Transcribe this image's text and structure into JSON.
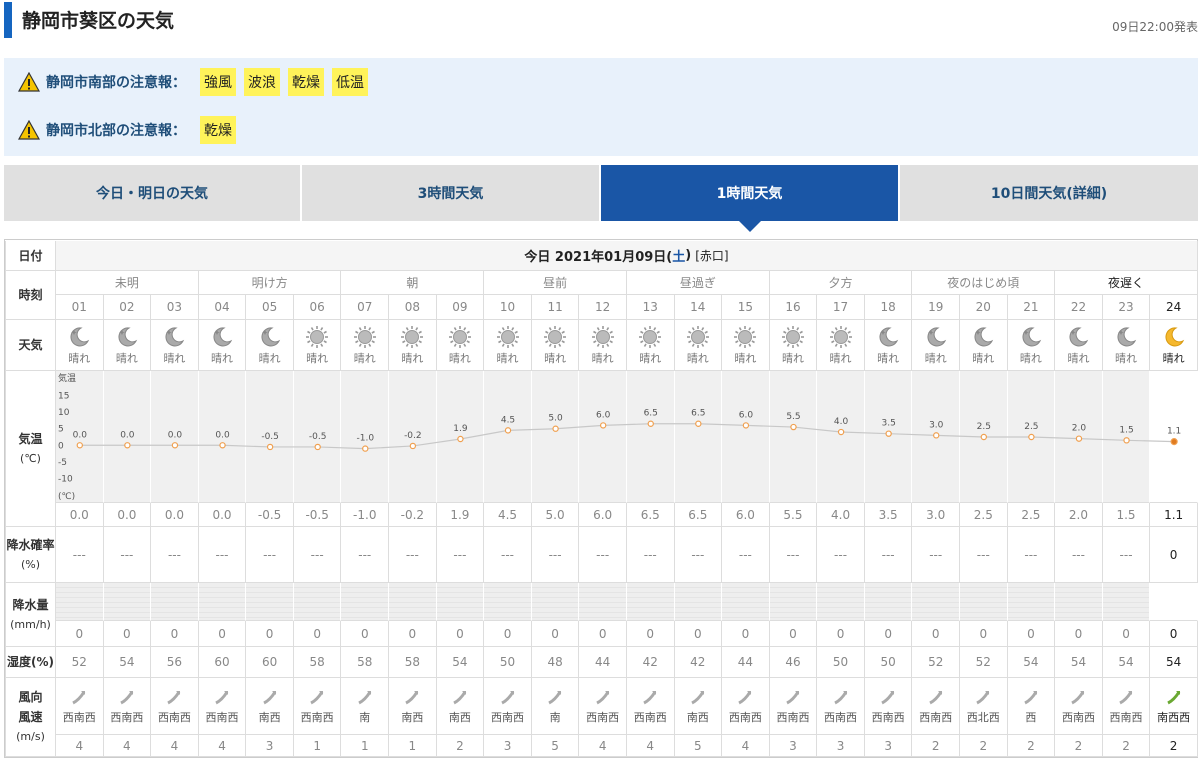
{
  "page": {
    "title": "静岡市葵区の天気",
    "published": "09日22:00発表"
  },
  "warnings": [
    {
      "label": "静岡市南部の注意報：",
      "items": [
        "強風",
        "波浪",
        "乾燥",
        "低温"
      ]
    },
    {
      "label": "静岡市北部の注意報：",
      "items": [
        "乾燥"
      ]
    }
  ],
  "tabs": [
    "今日・明日の天気",
    "3時間天気",
    "1時間天気",
    "10日間天気(詳細)"
  ],
  "active_tab": 2,
  "table": {
    "labels": {
      "date": "日付",
      "time": "時刻",
      "weather": "天気",
      "temp": "気温",
      "temp_unit": "(℃)",
      "precip_prob": "降水確率",
      "precip_prob_unit": "(%)",
      "precip": "降水量",
      "precip_unit": "(mm/h)",
      "humidity": "湿度(%)",
      "wind1": "風向",
      "wind2": "風速",
      "wind_unit": "(m/s)"
    },
    "date_prefix": "今日 2021年01月09日(",
    "day": "土",
    "date_suffix": ")",
    "location": "[赤口]",
    "periods": [
      "未明",
      "明け方",
      "朝",
      "昼前",
      "昼過ぎ",
      "夕方",
      "夜のはじめ頃",
      "夜遅く"
    ],
    "hours": [
      "01",
      "02",
      "03",
      "04",
      "05",
      "06",
      "07",
      "08",
      "09",
      "10",
      "11",
      "12",
      "13",
      "14",
      "15",
      "16",
      "17",
      "18",
      "19",
      "20",
      "21",
      "22",
      "23",
      "24"
    ],
    "weather": [
      "晴れ",
      "晴れ",
      "晴れ",
      "晴れ",
      "晴れ",
      "晴れ",
      "晴れ",
      "晴れ",
      "晴れ",
      "晴れ",
      "晴れ",
      "晴れ",
      "晴れ",
      "晴れ",
      "晴れ",
      "晴れ",
      "晴れ",
      "晴れ",
      "晴れ",
      "晴れ",
      "晴れ",
      "晴れ",
      "晴れ",
      "晴れ"
    ],
    "weather_icons": [
      "moon-icon",
      "moon-icon",
      "moon-icon",
      "moon-icon",
      "moon-icon",
      "sun-icon",
      "sun-icon",
      "sun-icon",
      "sun-icon",
      "sun-icon",
      "sun-icon",
      "sun-icon",
      "sun-icon",
      "sun-icon",
      "sun-icon",
      "sun-icon",
      "sun-icon",
      "moon-icon",
      "moon-icon",
      "moon-icon",
      "moon-icon",
      "moon-icon",
      "moon-icon",
      "moon-icon"
    ],
    "temps": [
      "0.0",
      "0.0",
      "0.0",
      "0.0",
      "-0.5",
      "-0.5",
      "-1.0",
      "-0.2",
      "1.9",
      "4.5",
      "5.0",
      "6.0",
      "6.5",
      "6.5",
      "6.0",
      "5.5",
      "4.0",
      "3.5",
      "3.0",
      "2.5",
      "2.5",
      "2.0",
      "1.5",
      "1.1"
    ],
    "precip_prob": [
      "---",
      "---",
      "---",
      "---",
      "---",
      "---",
      "---",
      "---",
      "---",
      "---",
      "---",
      "---",
      "---",
      "---",
      "---",
      "---",
      "---",
      "---",
      "---",
      "---",
      "---",
      "---",
      "---",
      "0"
    ],
    "precip": [
      "0",
      "0",
      "0",
      "0",
      "0",
      "0",
      "0",
      "0",
      "0",
      "0",
      "0",
      "0",
      "0",
      "0",
      "0",
      "0",
      "0",
      "0",
      "0",
      "0",
      "0",
      "0",
      "0",
      "0"
    ],
    "humidity": [
      "52",
      "54",
      "56",
      "60",
      "60",
      "58",
      "58",
      "58",
      "54",
      "50",
      "48",
      "44",
      "42",
      "42",
      "44",
      "46",
      "50",
      "50",
      "52",
      "52",
      "54",
      "54",
      "54",
      "54"
    ],
    "wind_dir": [
      "西南西",
      "西南西",
      "西南西",
      "西南西",
      "南西",
      "西南西",
      "南",
      "南西",
      "南西",
      "西南西",
      "南",
      "西南西",
      "西南西",
      "南西",
      "西南西",
      "西南西",
      "西南西",
      "西南西",
      "西南西",
      "西北西",
      "西",
      "西南西",
      "西南西",
      "南西西"
    ],
    "wind_speed": [
      "4",
      "4",
      "4",
      "4",
      "3",
      "1",
      "1",
      "1",
      "2",
      "3",
      "5",
      "4",
      "4",
      "5",
      "4",
      "3",
      "3",
      "3",
      "2",
      "2",
      "2",
      "2",
      "2",
      "2"
    ]
  },
  "chart_data": {
    "type": "line",
    "title": "",
    "ylabel": "気温",
    "unit": "(℃)",
    "yticks": [
      "15",
      "10",
      "5",
      "0",
      "-5",
      "-10"
    ],
    "ylim": [
      -15,
      20
    ],
    "x": [
      "01",
      "02",
      "03",
      "04",
      "05",
      "06",
      "07",
      "08",
      "09",
      "10",
      "11",
      "12",
      "13",
      "14",
      "15",
      "16",
      "17",
      "18",
      "19",
      "20",
      "21",
      "22",
      "23",
      "24"
    ],
    "series": [
      {
        "name": "気温",
        "values": [
          0.0,
          0.0,
          0.0,
          0.0,
          -0.5,
          -0.5,
          -1.0,
          -0.2,
          1.9,
          4.5,
          5.0,
          6.0,
          6.5,
          6.5,
          6.0,
          5.5,
          4.0,
          3.5,
          3.0,
          2.5,
          2.5,
          2.0,
          1.5,
          1.1
        ]
      }
    ],
    "colors": {
      "line": "#c8c8c8",
      "point": "#f0a050",
      "last_point": "#e07b20"
    }
  }
}
